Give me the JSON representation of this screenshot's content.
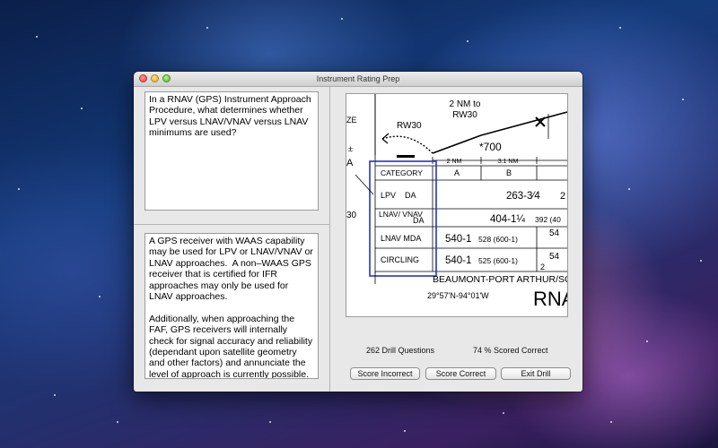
{
  "window": {
    "title": "Instrument Rating Prep"
  },
  "question": {
    "text": "In a RNAV (GPS) Instrument Approach Procedure, what determines whether LPV versus LNAV/VNAV versus LNAV minimums are used?"
  },
  "answer": {
    "text": "A GPS receiver with WAAS capability may be used for LPV or LNAV/VNAV or LNAV approaches.  A non–WAAS GPS receiver that is certified for IFR approaches may only be used for LNAV approaches.\n\nAdditionally, when approaching the FAF, GPS receivers will internally check for signal accuracy and reliability (dependant upon satellite geometry and other factors) and annunciate the level of approach is currently possible."
  },
  "chart": {
    "top_note": "2 NM to",
    "top_note2": "RW30",
    "runway_label": "RW30",
    "altitude": "*700",
    "seg1": "2 NM",
    "seg2": "3.1 NM",
    "header_category": "CATEGORY",
    "col_a": "A",
    "col_b": "B",
    "rows": [
      {
        "label": "LPV    DA",
        "val1": "263-3⁄4",
        "val2": ""
      },
      {
        "label": "LNAV/ VNAV",
        "label2": "DA",
        "val1": "404-1¼",
        "val2": "392 (40"
      },
      {
        "label": "LNAV MDA",
        "val1": "540-1",
        "val2": "528 (600-1)"
      },
      {
        "label": "CIRCLING",
        "val1": "540-1",
        "val2": "525 (600-1)"
      }
    ],
    "airport": "BEAUMONT-PORT ARTHUR/SO",
    "coords": "29°57'N-94°01'W",
    "proc": "RNA",
    "left_marks": {
      "m1": "ZE",
      "m2": "±",
      "m3": "A",
      "m4": "30"
    },
    "right_partial": {
      "r1": "54",
      "r2": "54",
      "r3": "2"
    }
  },
  "stats": {
    "drill_questions": "262  Drill Questions",
    "scored_correct": "74 % Scored Correct"
  },
  "buttons": {
    "incorrect": "Score Incorrect",
    "correct": "Score Correct",
    "exit": "Exit Drill"
  }
}
